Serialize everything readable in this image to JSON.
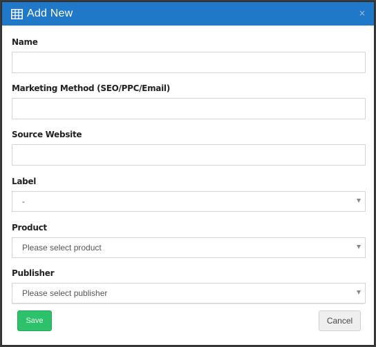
{
  "modal": {
    "title": "Add New",
    "close_label": "×"
  },
  "form": {
    "name_label": "Name",
    "name_value": "",
    "marketing_label": "Marketing Method (SEO/PPC/Email)",
    "marketing_value": "",
    "source_label": "Source Website",
    "source_value": "",
    "label_label": "Label",
    "label_selected": "-",
    "product_label": "Product",
    "product_selected": "Please select product",
    "publisher_label": "Publisher",
    "publisher_selected": "Please select publisher"
  },
  "footer": {
    "save_label": "Save",
    "cancel_label": "Cancel"
  },
  "colors": {
    "header": "#1f78c8",
    "save": "#2ec16b",
    "cancel": "#efefef"
  },
  "icons": {
    "header": "table-icon",
    "close": "close-icon",
    "dropdown": "chevron-down-icon"
  }
}
